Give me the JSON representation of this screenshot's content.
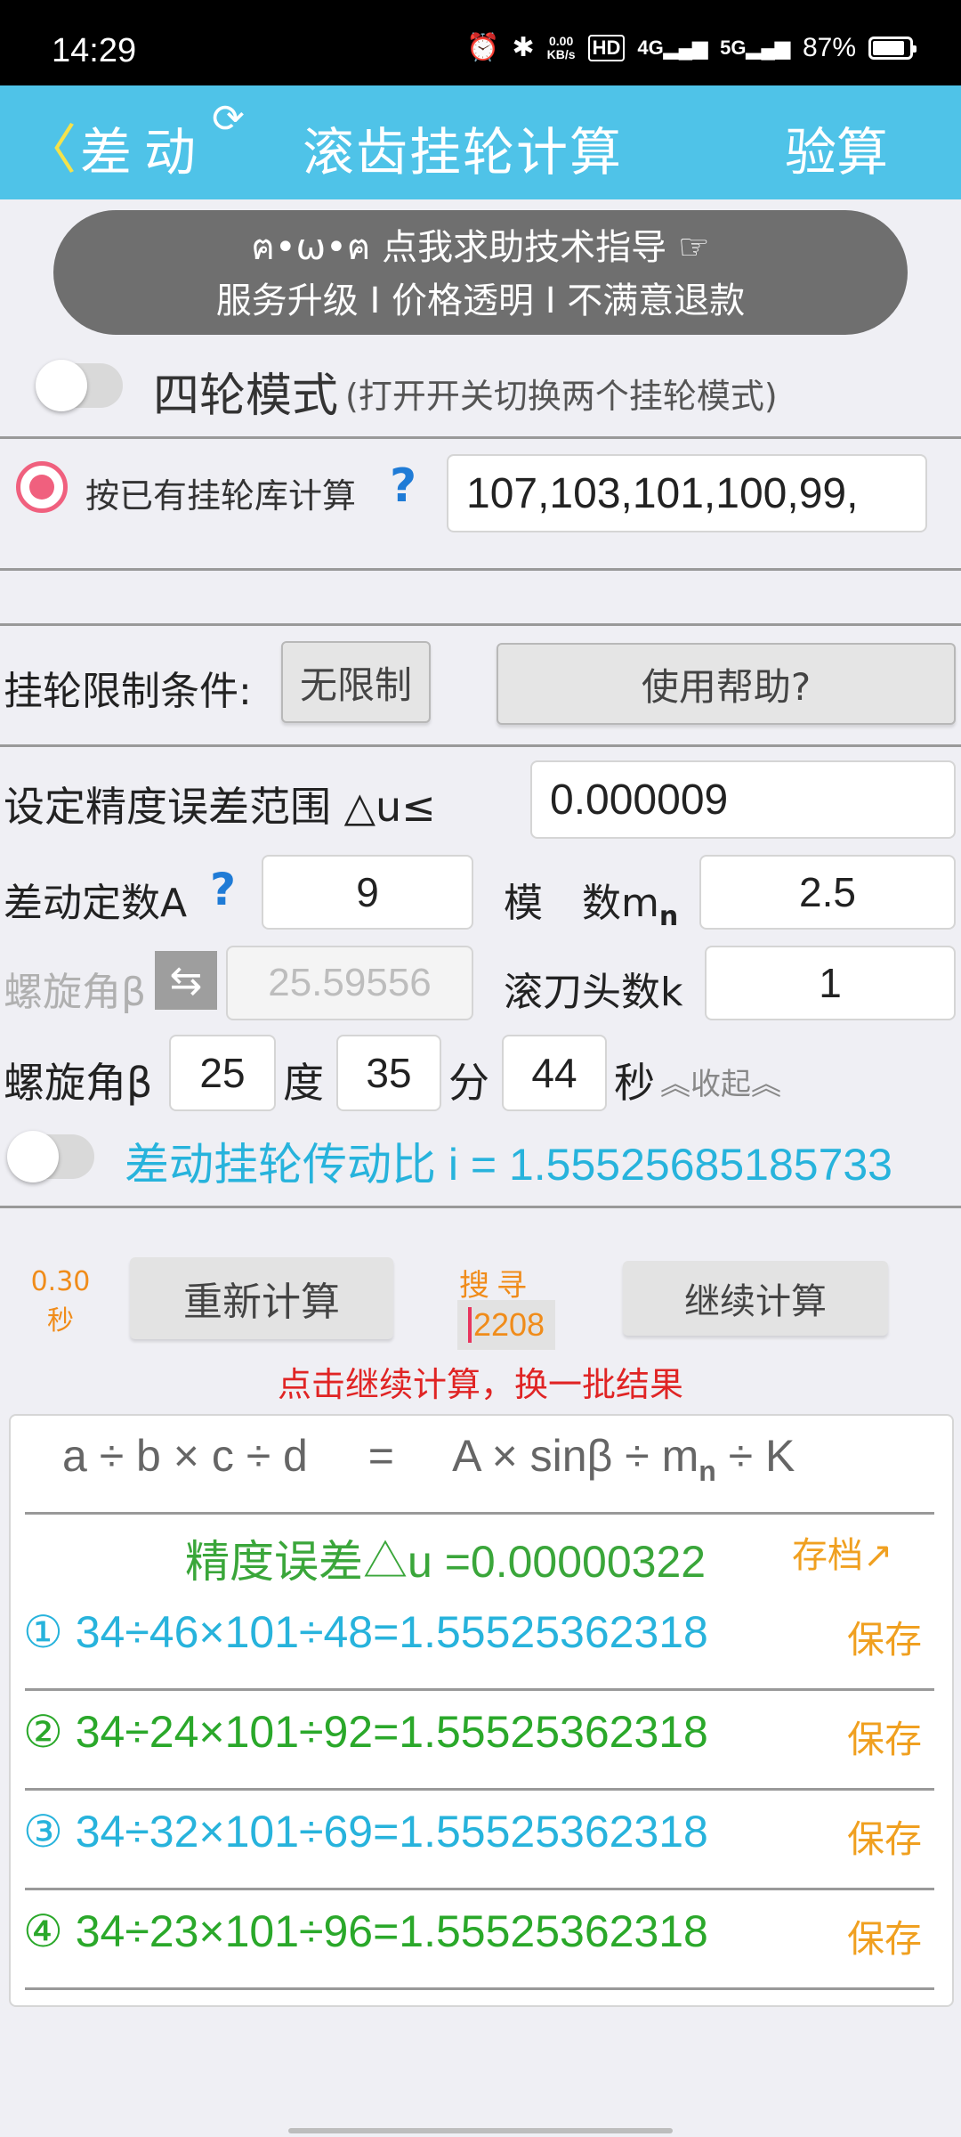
{
  "status_bar": {
    "time": "14:29",
    "net_speed_value": "0.00",
    "net_speed_unit": "KB/s",
    "hd": "HD",
    "signal1": "4G",
    "signal2": "5G",
    "battery": "87%",
    "battery_level": 0.87
  },
  "header": {
    "back_glyph": "〈",
    "mode": "差动",
    "refresh_glyph": "⟳",
    "title": "滚齿挂轮计算",
    "verify": "验算"
  },
  "banner": {
    "line1": "ฅ•ω•ฅ 点我求助技术指导 ☞",
    "line2": "服务升级 I 价格透明 I 不满意退款"
  },
  "four_wheel": {
    "label": "四轮模式",
    "hint": "(打开开关切换两个挂轮模式)"
  },
  "library": {
    "label": "按已有挂轮库计算",
    "help": "?",
    "value": "107,103,101,100,99,"
  },
  "limit": {
    "label": "挂轮限制条件:",
    "button": "无限制",
    "help_button": "使用帮助?"
  },
  "precision_setting": {
    "label": "设定精度误差范围 △u≤",
    "value": "0.000009"
  },
  "params": {
    "diff_const_label": "差动定数A",
    "diff_const_help": "?",
    "diff_const_value": "9",
    "modulus_label": "模　数m",
    "modulus_sub": "n",
    "modulus_value": "2.5",
    "helix_label": "螺旋角β",
    "swap_glyph": "⇆",
    "helix_value": "25.59556",
    "hob_label": "滚刀头数k",
    "hob_value": "1"
  },
  "helix_dms": {
    "label": "螺旋角β",
    "deg": "25",
    "deg_unit": "度",
    "min": "35",
    "min_unit": "分",
    "sec": "44",
    "sec_unit": "秒",
    "collapse": "︽收起︽"
  },
  "ratio": {
    "text": "差动挂轮传动比 i = 1.55525685185733"
  },
  "actions": {
    "elapsed": "0.30",
    "elapsed_unit": "秒",
    "recalc": "重新计算",
    "search_label": "搜寻",
    "search_count": "2208",
    "continue": "继续计算",
    "tip": "点击继续计算，换一批结果"
  },
  "results": {
    "formula_left": "a ÷ b × c ÷ d",
    "formula_eq": "=",
    "formula_right": "A × sinβ ÷ m",
    "formula_sub": "n",
    "formula_tail": " ÷ K",
    "precision": "精度误差△u =0.00000322",
    "archive": "存档↗",
    "rows": [
      {
        "idx": "①",
        "expr": "34÷46×101÷48=1.55525362318",
        "save": "保存"
      },
      {
        "idx": "②",
        "expr": "34÷24×101÷92=1.55525362318",
        "save": "保存"
      },
      {
        "idx": "③",
        "expr": "34÷32×101÷69=1.55525362318",
        "save": "保存"
      },
      {
        "idx": "④",
        "expr": "34÷23×101÷96=1.55525362318",
        "save": "保存"
      }
    ]
  },
  "colors": {
    "header_bg": "#4fc3e8",
    "accent_blue": "#27b3dc",
    "accent_green": "#2aa82a",
    "accent_orange": "#f0a020",
    "radio_pink": "#f0607e",
    "tip_red": "#e02424"
  }
}
